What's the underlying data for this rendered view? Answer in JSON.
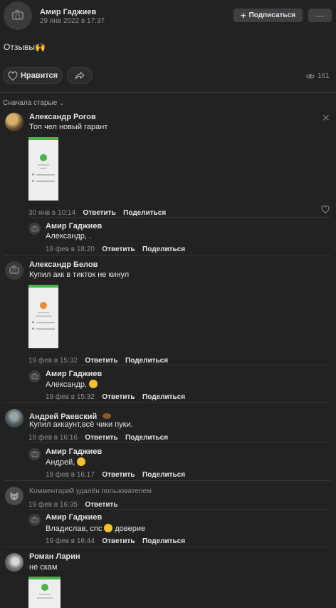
{
  "post": {
    "author": "Амир Гаджиев",
    "date": "29 янв 2022 в 17:37",
    "subscribe_label": "Подписаться",
    "more_label": "···",
    "text": "Отзывы🙌",
    "like_label": "Нравится",
    "views": "161"
  },
  "sort_label": "Сначала старые",
  "comments": [
    {
      "name": "Александр Рогов",
      "text": "Топ чел новый гарант",
      "date": "30 янв в 10:14",
      "reply": "Ответить",
      "share": "Поделиться"
    },
    {
      "name": "Амир Гаджиев",
      "text": "Александр, .",
      "date": "19 фев в 18:20",
      "reply": "Ответить",
      "share": "Поделиться"
    },
    {
      "name": "Александр Белов",
      "text": "Купил акк в тикток не кинул",
      "date": "19 фев в 15:32",
      "reply": "Ответить",
      "share": "Поделиться"
    },
    {
      "name": "Амир Гаджиев",
      "text": "Александр,",
      "date": "19 фев в 15:32",
      "reply": "Ответить",
      "share": "Поделиться"
    },
    {
      "name": "Андрей Раевский",
      "text": "Купил аккаунт,всё чики пуки.",
      "date": "19 фев в 16:16",
      "reply": "Ответить",
      "share": "Поделиться"
    },
    {
      "name": "Амир Гаджиев",
      "text": "Андрей,",
      "date": "19 фев в 16:17",
      "reply": "Ответить",
      "share": "Поделиться"
    },
    {
      "name": "",
      "text": "Комментарий удалён пользователем",
      "date": "19 фев в 16:35",
      "reply": "Ответить",
      "share": ""
    },
    {
      "name": "Амир Гаджиев",
      "text": "Владислав, спс",
      "text_after": "доверие",
      "date": "19 фев в 16:44",
      "reply": "Ответить",
      "share": "Поделиться"
    },
    {
      "name": "Роман Ларин",
      "text": "не скам",
      "date": "",
      "reply": "",
      "share": ""
    }
  ],
  "colors": {
    "background": "#222222",
    "accent_green": "#4bb34b",
    "muted": "#8b8e93"
  }
}
